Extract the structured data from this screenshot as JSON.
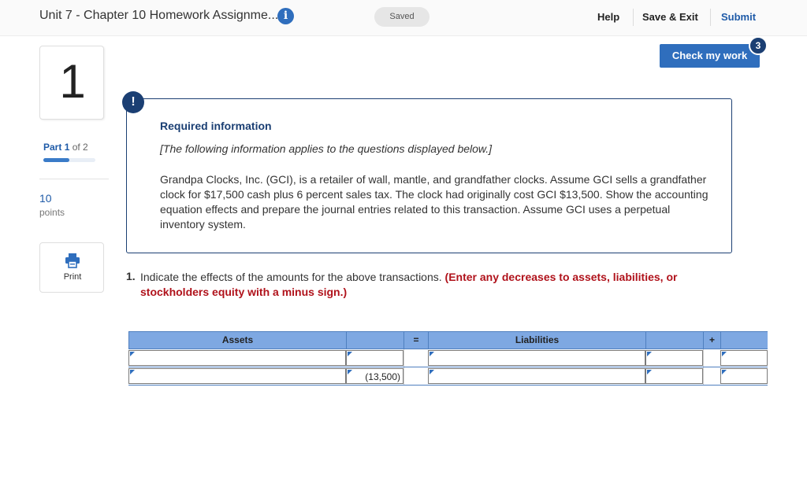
{
  "header": {
    "title": "Unit 7 - Chapter 10 Homework Assignme...",
    "info_icon": "i",
    "saved_label": "Saved",
    "help_label": "Help",
    "save_exit_label": "Save & Exit",
    "submit_label": "Submit"
  },
  "left": {
    "question_number": "1",
    "part_word": "Part",
    "part_current": "1",
    "part_of": "of 2",
    "part_progress": 0.5,
    "points_value": "10",
    "points_label": "points",
    "print_label": "Print"
  },
  "check": {
    "label": "Check my work",
    "badge": "3"
  },
  "required": {
    "alert": "!",
    "heading": "Required information",
    "italic": "[The following information applies to the questions displayed below.]",
    "body": "Grandpa Clocks, Inc. (GCI), is a retailer of wall, mantle, and grandfather clocks. Assume GCI sells a grandfather clock for $17,500 cash plus 6 percent sales tax. The clock had originally cost GCI $13,500. Show the accounting equation effects and prepare the journal entries related to this transaction. Assume GCI uses a perpetual inventory system."
  },
  "question": {
    "number": "1.",
    "text": "Indicate the effects of the amounts for the above transactions. ",
    "instruction": "(Enter any decreases to assets, liabilities, or stockholders equity with a minus sign.)"
  },
  "table": {
    "headers": [
      "Assets",
      "",
      "=",
      "Liabilities",
      "",
      "+",
      ""
    ],
    "rows": [
      [
        "",
        "",
        "",
        "",
        "",
        "",
        ""
      ],
      [
        "",
        "(13,500)",
        "",
        "",
        "",
        "",
        ""
      ]
    ]
  },
  "colors": {
    "accent": "#2f6ebd",
    "dark_navy": "#1b3f73",
    "table_header": "#7ea8e2",
    "instruction_red": "#b0121b"
  }
}
